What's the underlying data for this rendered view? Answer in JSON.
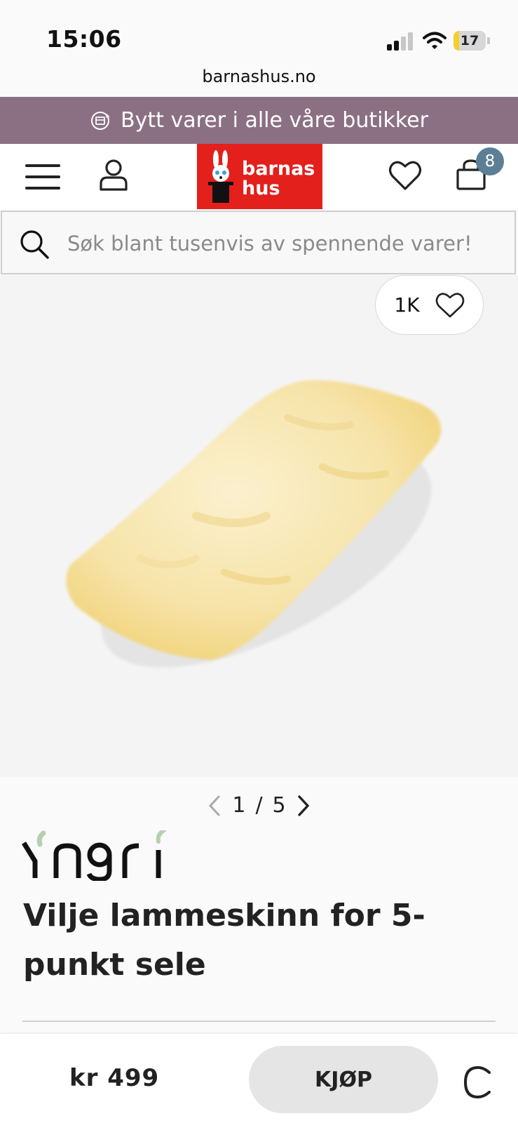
{
  "status_bar": {
    "time": "15:06",
    "battery": "17",
    "battery_level": 0.17
  },
  "browser": {
    "url": "barnashus.no"
  },
  "promo": {
    "text": "Bytt varer i alle våre butikker",
    "icon": "exchange-icon",
    "background": "#8b7083"
  },
  "header": {
    "menu_icon": "hamburger-menu-icon",
    "account_icon": "user-icon",
    "logo": {
      "line1": "barnas",
      "line2": "hus",
      "background": "#e3201b"
    },
    "wishlist_icon": "heart-icon",
    "cart_icon": "bag-icon",
    "cart_count": "8"
  },
  "search": {
    "placeholder": "Søk blant tusenvis av spennende varer!"
  },
  "gallery": {
    "likes": "1K",
    "current": "1",
    "separator": "/",
    "total": "5"
  },
  "product": {
    "brand": "Yngri",
    "title": "Vilje lammeskinn for 5-punkt sele",
    "price": "kr 499",
    "buy_label": "KJØP"
  }
}
